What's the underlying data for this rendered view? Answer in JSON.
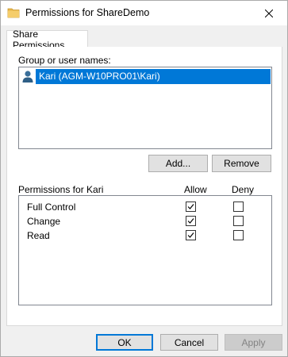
{
  "window": {
    "title": "Permissions for ShareDemo"
  },
  "tab": {
    "label": "Share Permissions"
  },
  "group": {
    "label": "Group or user names:",
    "users": [
      {
        "name": "Kari (AGM-W10PRO01\\Kari)",
        "selected": true
      }
    ]
  },
  "buttons": {
    "add": "Add...",
    "remove": "Remove",
    "ok": "OK",
    "cancel": "Cancel",
    "apply": "Apply"
  },
  "permissions": {
    "header": "Permissions for Kari",
    "allow_label": "Allow",
    "deny_label": "Deny",
    "rows": [
      {
        "name": "Full Control",
        "allow": true,
        "deny": false
      },
      {
        "name": "Change",
        "allow": true,
        "deny": false
      },
      {
        "name": "Read",
        "allow": true,
        "deny": false
      }
    ]
  },
  "colors": {
    "selection": "#0078d7",
    "folder": "#e8b64a"
  }
}
